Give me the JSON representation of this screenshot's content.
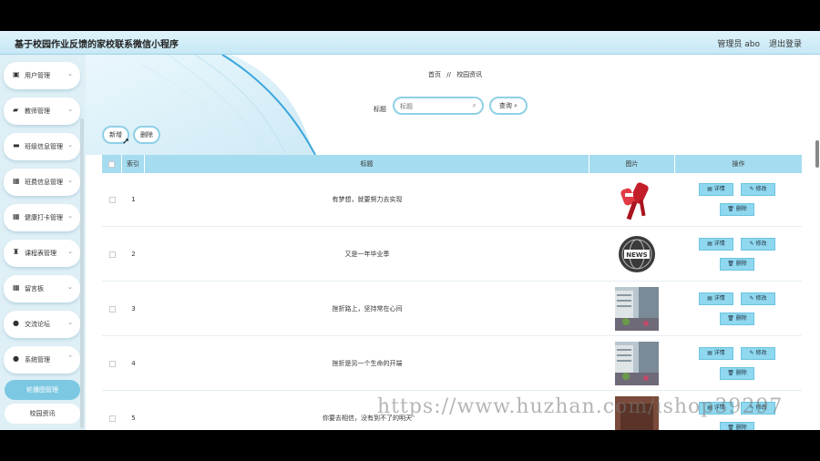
{
  "header": {
    "title": "基于校园作业反馈的家校联系微信小程序",
    "user": "管理员 abo",
    "logout": "退出登录"
  },
  "sidebar": {
    "items": [
      {
        "label": "用户管理",
        "icon": "user-card-icon"
      },
      {
        "label": "教师管理",
        "icon": "teacher-icon"
      },
      {
        "label": "班级信息管理",
        "icon": "briefcase-icon"
      },
      {
        "label": "班费信息管理",
        "icon": "grid-icon"
      },
      {
        "label": "健康打卡管理",
        "icon": "grid-icon"
      },
      {
        "label": "课程表管理",
        "icon": "trophy-icon"
      },
      {
        "label": "留言板",
        "icon": "grid-icon"
      },
      {
        "label": "交流论坛",
        "icon": "person-icon"
      },
      {
        "label": "系统管理",
        "icon": "person-icon"
      }
    ],
    "subitems": [
      {
        "label": "轮播图管理",
        "active": true
      },
      {
        "label": "校园资讯",
        "active": false
      }
    ]
  },
  "breadcrumb": {
    "home": "首页",
    "sep": "//",
    "current": "校园资讯"
  },
  "search": {
    "label": "标题",
    "placeholder": "标题",
    "button": "查询"
  },
  "actions": {
    "add": "新增",
    "delete": "删除"
  },
  "table": {
    "headers": {
      "index": "索引",
      "title": "标题",
      "image": "图片",
      "ops": "操作"
    },
    "rows": [
      {
        "index": "1",
        "title": "有梦想，就要努力去实现",
        "image": "microphones-image"
      },
      {
        "index": "2",
        "title": "又是一年毕业季",
        "image": "news-globe-image"
      },
      {
        "index": "3",
        "title": "挫折路上，坚持常在心间",
        "image": "campus-building-image"
      },
      {
        "index": "4",
        "title": "挫折是另一个生命的开端",
        "image": "campus-building-image"
      },
      {
        "index": "5",
        "title": "你要去相信，没有到不了的明天",
        "image": "campus-building-image"
      }
    ],
    "op_labels": {
      "detail": "详情",
      "edit": "修改",
      "delete": "删除"
    }
  },
  "watermark": "https://www.huzhan.com/ishop39297",
  "colors": {
    "accent": "#8fd0e6",
    "header_bg": "#a6dcef",
    "active": "#7cc8e2"
  }
}
